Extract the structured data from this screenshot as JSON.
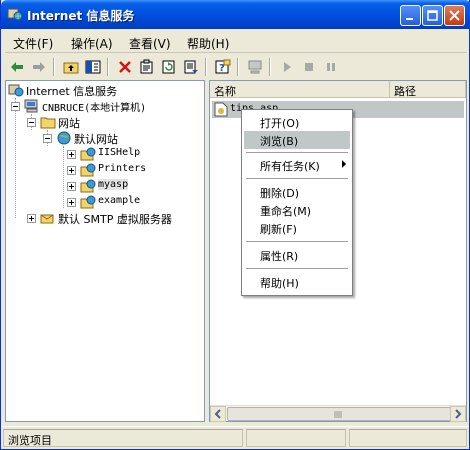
{
  "window": {
    "title": "Internet 信息服务"
  },
  "menubar": [
    {
      "label": "文件(F)"
    },
    {
      "label": "操作(A)"
    },
    {
      "label": "查看(V)"
    },
    {
      "label": "帮助(H)"
    }
  ],
  "tree": {
    "root": "Internet 信息服务",
    "computer": "CNBRUCE(本地计算机)",
    "websites": "网站",
    "default_site": "默认网站",
    "children": [
      "IISHelp",
      "Printers",
      "myasp",
      "example"
    ],
    "smtp": "默认 SMTP 虚拟服务器"
  },
  "list": {
    "columns": [
      "名称",
      "路径"
    ],
    "items": [
      {
        "name": "tips.asp"
      }
    ]
  },
  "context_menu": {
    "items": [
      {
        "label": "打开(O)"
      },
      {
        "label": "浏览(B)"
      },
      {
        "label": "所有任务(K)"
      },
      {
        "label": "删除(D)"
      },
      {
        "label": "重命名(M)"
      },
      {
        "label": "刷新(F)"
      },
      {
        "label": "属性(R)"
      },
      {
        "label": "帮助(H)"
      }
    ]
  },
  "statusbar": {
    "text": "浏览项目"
  },
  "toolbar": {
    "icons": [
      "back-icon",
      "forward-icon",
      "up-folder-icon",
      "show-tree-icon",
      "delete-icon",
      "properties-icon",
      "refresh-icon",
      "export-icon",
      "help-icon",
      "computer-icon",
      "play-icon",
      "stop-icon",
      "pause-icon"
    ]
  },
  "colors": {
    "title_bar": "#0054e3",
    "selection": "#c1c6c6",
    "face": "#ece9d8"
  }
}
